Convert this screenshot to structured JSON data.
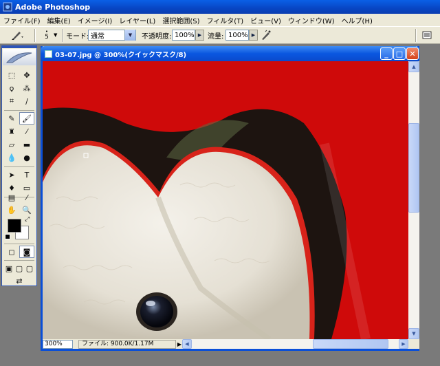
{
  "app": {
    "title": "Adobe Photoshop"
  },
  "menu": [
    "ファイル(F)",
    "編集(E)",
    "イメージ(I)",
    "レイヤー(L)",
    "選択範囲(S)",
    "フィルタ(T)",
    "ビュー(V)",
    "ウィンドウ(W)",
    "ヘルプ(H)"
  ],
  "options": {
    "brush_size": "5",
    "mode_label": "モード:",
    "mode_value": "通常",
    "opacity_label": "不透明度:",
    "opacity_value": "100%",
    "flow_label": "流量:",
    "flow_value": "100%"
  },
  "document": {
    "title": "03-07.jpg @ 300%(クイックマスク/8)",
    "zoom": "300%",
    "file_size": "ファイル: 900.0K/1.17M"
  },
  "colors": {
    "quickmask_red": "#cf0a0a",
    "foreground": "#000000",
    "background": "#ffffff",
    "title_blue": "#0a57e0"
  },
  "icons": [
    "photoshop-icon",
    "brush-preset-icon",
    "airbrush-icon",
    "palette-well-icon",
    "minimize-icon",
    "maximize-icon",
    "close-icon"
  ]
}
